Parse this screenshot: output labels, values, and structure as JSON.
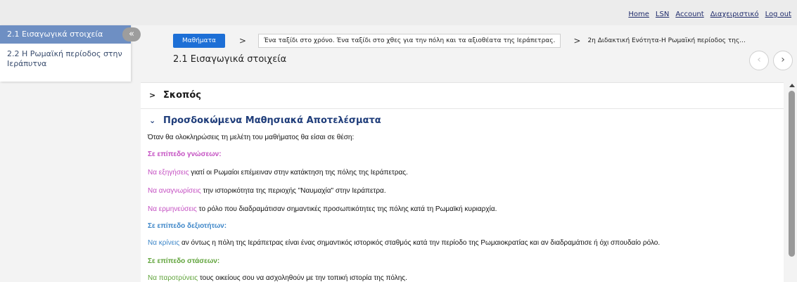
{
  "topnav": [
    "Home",
    "LSN",
    "Account",
    "Διαχειριστικό",
    "Log out"
  ],
  "sidebar": {
    "items": [
      {
        "label": "2.1 Εισαγωγικά στοιχεία"
      },
      {
        "label": "2.2 Η Ρωμαϊκή περίοδος στην Ιεράπυτνα"
      }
    ],
    "collapse_icon": "«"
  },
  "breadcrumb": {
    "root": "Μαθήματα",
    "sep": ">",
    "lesson": "Ένα ταξίδι στο χρόνο. Ένα ταξίδι στο χθες για την πόλη και τα αξιοθέατα της Ιεράπετρας.",
    "unit": "2η Διδακτική Ενότητα-Η Ρωμαϊκή περίοδος της..."
  },
  "page_title": "2.1 Εισαγωγικά στοιχεία",
  "nav": {
    "prev": "‹",
    "next": "›"
  },
  "sections": {
    "purpose": {
      "chev": ">",
      "title": "Σκοπός"
    },
    "outcomes": {
      "chev": "⌄",
      "title": "Προσδοκώμενα Μαθησιακά Αποτελέσματα"
    }
  },
  "intro": "Όταν θα ολοκληρώσεις τη μελέτη του μαθήματος θα είσαι σε θέση:",
  "levels": {
    "knowledge": "Σε επίπεδο γνώσεων:",
    "skills": "Σε επίπεδο δεξιοτήτων:",
    "attitudes": "Σε επίπεδο στάσεων:"
  },
  "items": [
    {
      "verb": "Να εξηγήσεις",
      "rest": " γιατί οι Ρωμαίοι επέμειναν στην κατάκτηση της πόλης της Ιεράπετρας."
    },
    {
      "verb": "Να αναγνωρίσεις",
      "rest": " την ιστορικότητα της περιοχής \"Ναυμαχία\" στην Ιεράπετρα."
    },
    {
      "verb": "Να ερμηνεύσεις",
      "rest": " το ρόλο που διαδραμάτισαν σημαντικές προσωπικότητες της πόλης κατά τη Ρωμαϊκή κυριαρχία."
    },
    {
      "verb": "Να κρίνεις",
      "rest": " αν όντως η πόλη της Ιεράπετρας είναι ένας σημαντικός ιστορικός σταθμός κατά την περίοδο της Ρωμαιοκρατίας και αν διαδραμάτισε ή όχι σπουδαίο ρόλο."
    },
    {
      "verb": "Να παροτρύνεις",
      "rest": " τους οικείους σου να ασχοληθούν με την τοπική ιστορία της πόλης."
    }
  ],
  "colors": {
    "accent": "#1d6fd6",
    "sidebar_active": "#6e8fc3",
    "knowledge": "#c44fc2",
    "skills": "#3d86c8",
    "attitudes": "#5fa33a"
  }
}
